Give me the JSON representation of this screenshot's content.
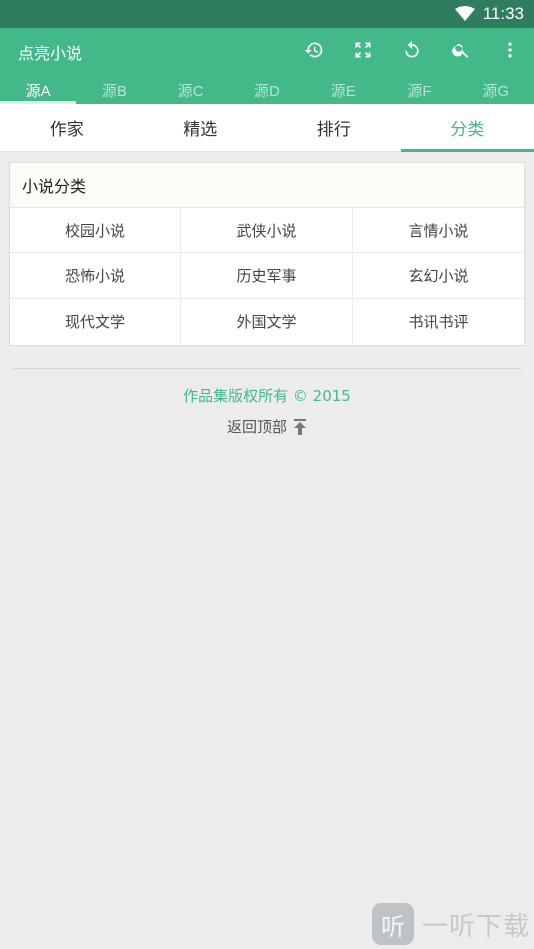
{
  "status_bar": {
    "time": "11:33"
  },
  "app_bar": {
    "title": "点亮小说",
    "actions": [
      "history-icon",
      "fullscreen-icon",
      "refresh-icon",
      "search-icon",
      "more-vert-icon"
    ]
  },
  "source_tabs": [
    {
      "label": "源A"
    },
    {
      "label": "源B"
    },
    {
      "label": "源C"
    },
    {
      "label": "源D"
    },
    {
      "label": "源E"
    },
    {
      "label": "源F"
    },
    {
      "label": "源G"
    }
  ],
  "main_tabs": [
    {
      "label": "作家"
    },
    {
      "label": "精选"
    },
    {
      "label": "排行"
    },
    {
      "label": "分类"
    }
  ],
  "category_panel": {
    "title": "小说分类",
    "items": [
      {
        "label": "校园小说"
      },
      {
        "label": "武侠小说"
      },
      {
        "label": "言情小说"
      },
      {
        "label": "恐怖小说"
      },
      {
        "label": "历史军事"
      },
      {
        "label": "玄幻小说"
      },
      {
        "label": "现代文学"
      },
      {
        "label": "外国文学"
      },
      {
        "label": "书讯书评"
      }
    ]
  },
  "footer": {
    "copyright": "作品集版权所有 © 2015",
    "back_to_top": "返回顶部"
  },
  "watermark": {
    "logo": "听",
    "text": "一听下载"
  },
  "colors": {
    "primary": "#43b98a",
    "status_bar": "#2e7d5f",
    "background": "#ececec"
  }
}
